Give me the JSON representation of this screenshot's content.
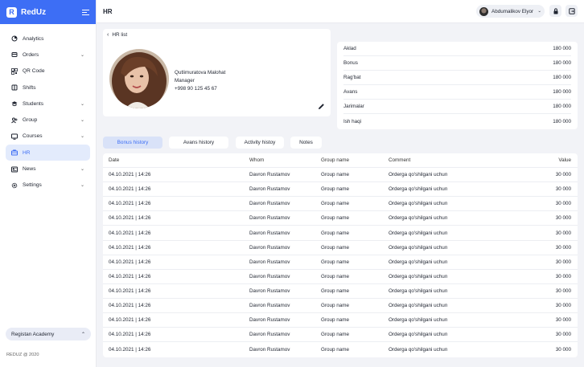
{
  "app": {
    "name": "RedUz",
    "logo_letter": "R",
    "accent": "#3d6ef5"
  },
  "sidebar": {
    "items": [
      {
        "label": "Analytics",
        "icon": "analytics-icon",
        "has_submenu": false
      },
      {
        "label": "Orders",
        "icon": "orders-icon",
        "has_submenu": true
      },
      {
        "label": "QR Code",
        "icon": "qr-code-icon",
        "has_submenu": false
      },
      {
        "label": "Shifts",
        "icon": "shifts-icon",
        "has_submenu": false
      },
      {
        "label": "Students",
        "icon": "students-icon",
        "has_submenu": true
      },
      {
        "label": "Group",
        "icon": "group-icon",
        "has_submenu": true
      },
      {
        "label": "Courses",
        "icon": "courses-icon",
        "has_submenu": true
      },
      {
        "label": "HR",
        "icon": "hr-icon",
        "has_submenu": false,
        "active": true
      },
      {
        "label": "News",
        "icon": "news-icon",
        "has_submenu": true
      },
      {
        "label": "Settings",
        "icon": "settings-icon",
        "has_submenu": true
      }
    ],
    "organization": "Registan Academy",
    "copyright": "REDUZ @ 2020"
  },
  "header": {
    "title": "HR",
    "user_name": "Abdumalikov Elyor"
  },
  "profile": {
    "back_label": "HR list",
    "name": "Qutlimuratova Malohat",
    "role": "Manager",
    "phone": "+998 90 125 45 67"
  },
  "salary": [
    {
      "label": "Aklad",
      "value": "180 000"
    },
    {
      "label": "Bonus",
      "value": "180 000"
    },
    {
      "label": "Rag'bat",
      "value": "180 000"
    },
    {
      "label": "Avans",
      "value": "180 000"
    },
    {
      "label": "Jarimalar",
      "value": "180 000"
    },
    {
      "label": "Ish haqi",
      "value": "180 000"
    }
  ],
  "tabs": [
    {
      "label": "Bonus history",
      "active": true
    },
    {
      "label": "Avans history",
      "active": false
    },
    {
      "label": "Activity histoy",
      "active": false
    },
    {
      "label": "Notes",
      "active": false
    }
  ],
  "table": {
    "columns": {
      "date": "Date",
      "whom": "Whom",
      "group": "Group name",
      "comment": "Comment",
      "value": "Value"
    },
    "rows": [
      {
        "date": "04.10.2021 | 14:26",
        "whom": "Davron Rustamov",
        "group": "Group name",
        "comment": "Orderga qo'shilgani uchun",
        "value": "30 000"
      },
      {
        "date": "04.10.2021 | 14:26",
        "whom": "Davron Rustamov",
        "group": "Group name",
        "comment": "Orderga qo'shilgani uchun",
        "value": "30 000"
      },
      {
        "date": "04.10.2021 | 14:26",
        "whom": "Davron Rustamov",
        "group": "Group name",
        "comment": "Orderga qo'shilgani uchun",
        "value": "30 000"
      },
      {
        "date": "04.10.2021 | 14:26",
        "whom": "Davron Rustamov",
        "group": "Group name",
        "comment": "Orderga qo'shilgani uchun",
        "value": "30 000"
      },
      {
        "date": "04.10.2021 | 14:26",
        "whom": "Davron Rustamov",
        "group": "Group name",
        "comment": "Orderga qo'shilgani uchun",
        "value": "30 000"
      },
      {
        "date": "04.10.2021 | 14:26",
        "whom": "Davron Rustamov",
        "group": "Group name",
        "comment": "Orderga qo'shilgani uchun",
        "value": "30 000"
      },
      {
        "date": "04.10.2021 | 14:26",
        "whom": "Davron Rustamov",
        "group": "Group name",
        "comment": "Orderga qo'shilgani uchun",
        "value": "30 000"
      },
      {
        "date": "04.10.2021 | 14:26",
        "whom": "Davron Rustamov",
        "group": "Group name",
        "comment": "Orderga qo'shilgani uchun",
        "value": "30 000"
      },
      {
        "date": "04.10.2021 | 14:26",
        "whom": "Davron Rustamov",
        "group": "Group name",
        "comment": "Orderga qo'shilgani uchun",
        "value": "30 000"
      },
      {
        "date": "04.10.2021 | 14:26",
        "whom": "Davron Rustamov",
        "group": "Group name",
        "comment": "Orderga qo'shilgani uchun",
        "value": "30 000"
      },
      {
        "date": "04.10.2021 | 14:26",
        "whom": "Davron Rustamov",
        "group": "Group name",
        "comment": "Orderga qo'shilgani uchun",
        "value": "30 000"
      },
      {
        "date": "04.10.2021 | 14:26",
        "whom": "Davron Rustamov",
        "group": "Group name",
        "comment": "Orderga qo'shilgani uchun",
        "value": "30 000"
      },
      {
        "date": "04.10.2021 | 14:26",
        "whom": "Davron Rustamov",
        "group": "Group name",
        "comment": "Orderga qo'shilgani uchun",
        "value": "30 000"
      }
    ]
  }
}
